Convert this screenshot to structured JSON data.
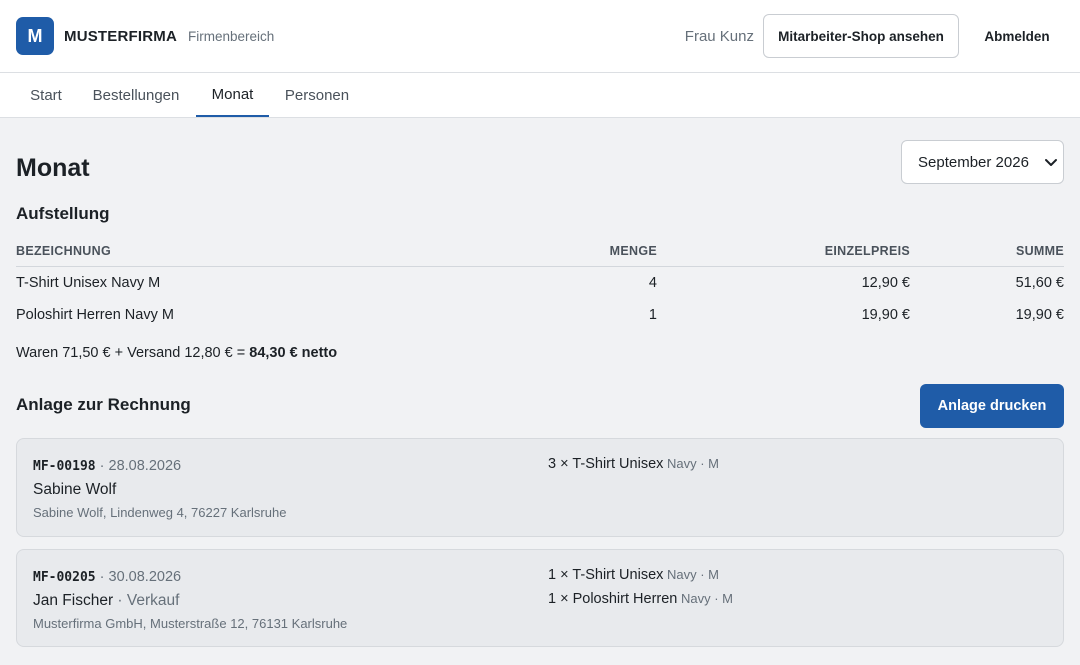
{
  "header": {
    "logo_letter": "M",
    "brand": "MUSTERFIRMA",
    "brand_sub": "Firmenbereich",
    "user_name": "Frau Kunz",
    "shop_button": "Mitarbeiter-Shop ansehen",
    "logout_button": "Abmelden"
  },
  "tabs": [
    {
      "label": "Start",
      "active": false
    },
    {
      "label": "Bestellungen",
      "active": false
    },
    {
      "label": "Monat",
      "active": true
    },
    {
      "label": "Personen",
      "active": false
    }
  ],
  "page_title": "Monat",
  "month_select": {
    "value": "September 2026"
  },
  "summary": {
    "title": "Aufstellung",
    "columns": [
      "BEZEICHNUNG",
      "MENGE",
      "EINZELPREIS",
      "SUMME"
    ],
    "rows": [
      {
        "name": "T-Shirt Unisex Navy M",
        "qty": "4",
        "unit": "12,90 €",
        "sum": "51,60 €"
      },
      {
        "name": "Poloshirt Herren Navy M",
        "qty": "1",
        "unit": "19,90 €",
        "sum": "19,90 €"
      }
    ],
    "totals_text": "Waren 71,50 € + Versand 12,80 € = ",
    "totals_bold": "84,30 € netto"
  },
  "annex": {
    "title": "Anlage zur Rechnung",
    "print_button": "Anlage drucken",
    "orders": [
      {
        "id": "MF-00198",
        "date": " · 28.08.2026",
        "customer": "Sabine Wolf",
        "department": "",
        "address": "Sabine Wolf, Lindenweg 4, 76227 Karlsruhe",
        "items": [
          {
            "text": "3 × T-Shirt Unisex",
            "variant": " Navy · M"
          }
        ]
      },
      {
        "id": "MF-00205",
        "date": " · 30.08.2026",
        "customer": "Jan Fischer",
        "department": " · Verkauf",
        "address": "Musterfirma GmbH, Musterstraße 12, 76131 Karlsruhe",
        "items": [
          {
            "text": "1 × T-Shirt Unisex",
            "variant": " Navy · M"
          },
          {
            "text": "1 × Poloshirt Herren",
            "variant": " Navy · M"
          }
        ]
      }
    ]
  },
  "colors": {
    "accent": "#1f5ca8",
    "background": "#f1f2f4",
    "card": "#e8eaed"
  }
}
